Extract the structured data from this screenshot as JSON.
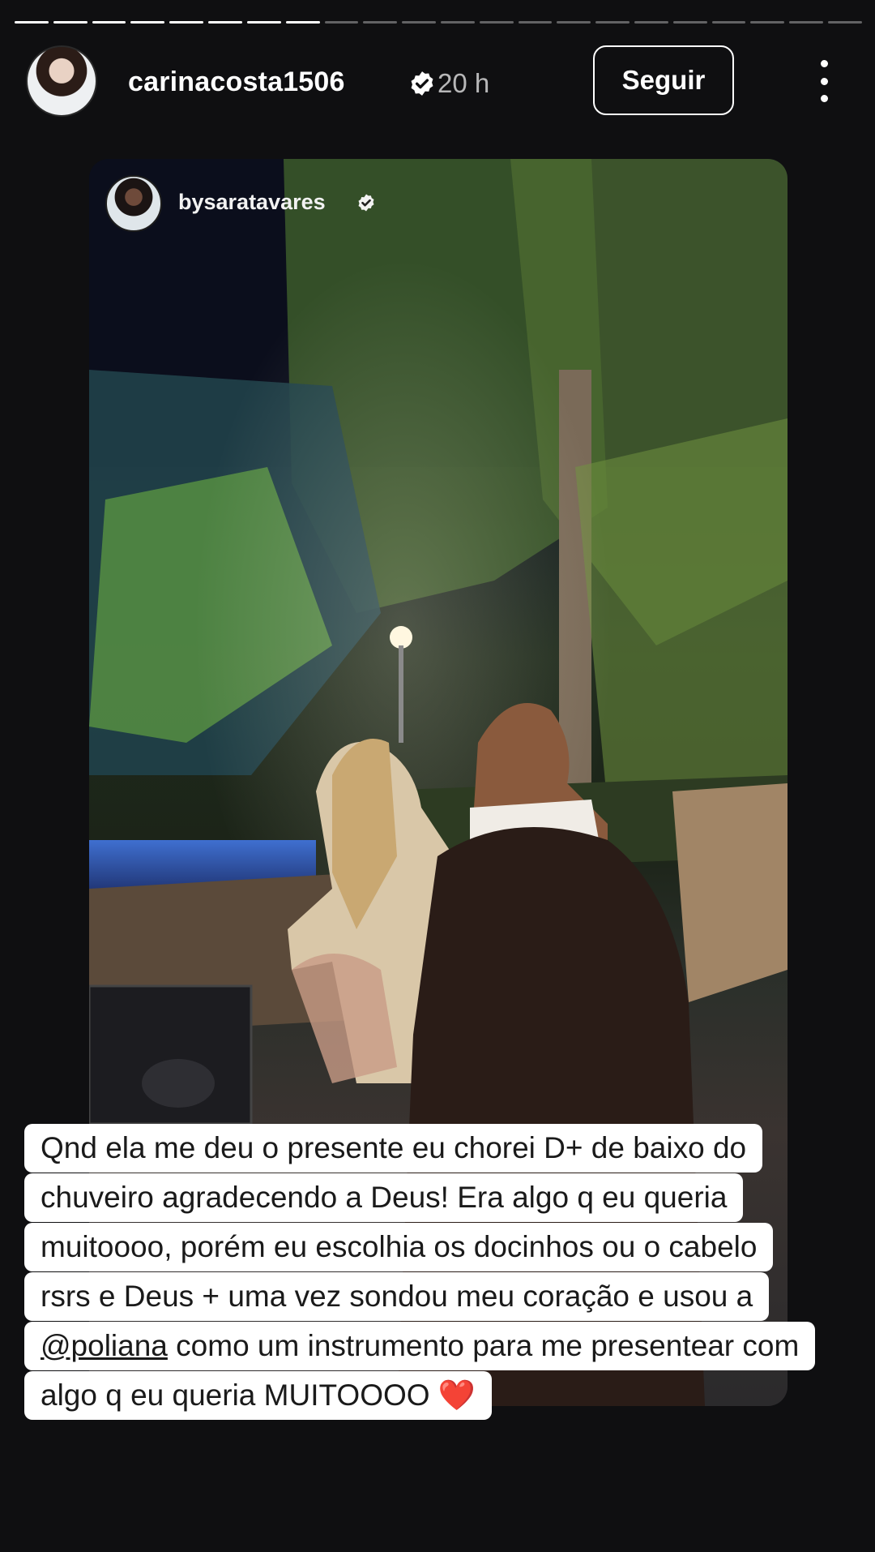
{
  "progress": {
    "segments": 22,
    "completed": 8
  },
  "header": {
    "username": "carinacosta1506",
    "time": "20 h",
    "follow_label": "Seguir"
  },
  "shared_post": {
    "username": "bysaratavares"
  },
  "caption": {
    "lines": [
      "Qnd ela me deu o presente eu chorei D+ de baixo do",
      "chuveiro agradecendo a Deus! Era algo q eu queria",
      "muitoooo, porém eu escolhia os docinhos ou o cabelo",
      "rsrs e Deus + uma vez sondou meu coração e usou a"
    ],
    "mention": "@poliana",
    "line5_rest": " como um instrumento para me presentear com",
    "line6": "algo q eu queria MUITOOOO ",
    "emoji": "❤️"
  },
  "colors": {
    "background": "#0f0f11",
    "verified_badge": "#ffffff",
    "heart": "#e01b2b"
  },
  "icons": [
    "verified-badge-icon",
    "more-options-icon",
    "heart-emoji"
  ]
}
